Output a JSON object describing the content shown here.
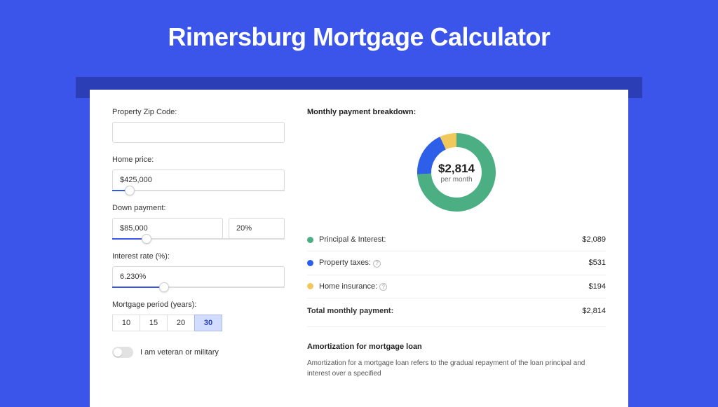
{
  "hero": {
    "title": "Rimersburg Mortgage Calculator"
  },
  "form": {
    "zip": {
      "label": "Property Zip Code:",
      "value": ""
    },
    "home_price": {
      "label": "Home price:",
      "value": "$425,000",
      "slider_pct": 10
    },
    "down_payment": {
      "label": "Down payment:",
      "amount": "$85,000",
      "pct": "20%",
      "slider_pct": 20
    },
    "interest": {
      "label": "Interest rate (%):",
      "value": "6.230%",
      "slider_pct": 30
    },
    "period": {
      "label": "Mortgage period (years):",
      "options": [
        "10",
        "15",
        "20",
        "30"
      ],
      "active": "30"
    },
    "veteran": {
      "label": "I am veteran or military",
      "on": false
    }
  },
  "breakdown": {
    "title": "Monthly payment breakdown:",
    "center_amount": "$2,814",
    "center_sub": "per month",
    "items": [
      {
        "label": "Principal & Interest:",
        "value": "$2,089",
        "color": "#4CAF84",
        "help": false
      },
      {
        "label": "Property taxes:",
        "value": "$531",
        "color": "#2E5FE8",
        "help": true
      },
      {
        "label": "Home insurance:",
        "value": "$194",
        "color": "#F1C85B",
        "help": true
      }
    ],
    "total": {
      "label": "Total monthly payment:",
      "value": "$2,814"
    }
  },
  "amort": {
    "title": "Amortization for mortgage loan",
    "body": "Amortization for a mortgage loan refers to the gradual repayment of the loan principal and interest over a specified"
  },
  "chart_data": {
    "type": "pie",
    "title": "Monthly payment breakdown",
    "series": [
      {
        "name": "Principal & Interest",
        "value": 2089,
        "color": "#4CAF84"
      },
      {
        "name": "Property taxes",
        "value": 531,
        "color": "#2E5FE8"
      },
      {
        "name": "Home insurance",
        "value": 194,
        "color": "#F1C85B"
      }
    ],
    "total": 2814,
    "units": "USD per month"
  }
}
